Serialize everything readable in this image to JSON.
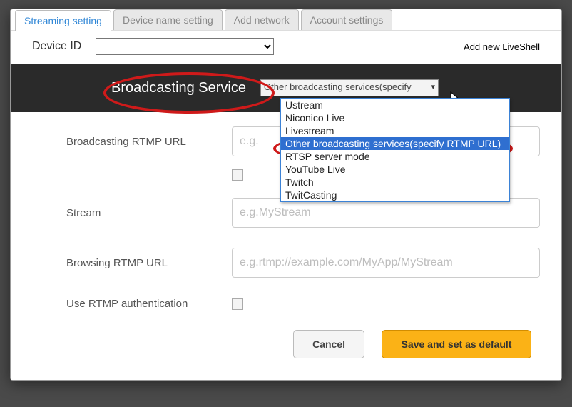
{
  "tabs": [
    "Streaming setting",
    "Device name setting",
    "Add network",
    "Account settings"
  ],
  "activeTab": 0,
  "deviceRow": {
    "label": "Device ID",
    "addLink": "Add new LiveShell"
  },
  "band": {
    "label": "Broadcasting Service",
    "selected": "Other broadcasting services(specify"
  },
  "dropdown": {
    "options": [
      "Ustream",
      "Niconico Live",
      "Livestream",
      "Other broadcasting services(specify RTMP URL)",
      "RTSP server mode",
      "YouTube Live",
      "Twitch",
      "TwitCasting"
    ],
    "highlightedIndex": 3
  },
  "form": {
    "rtmpUrl": {
      "label": "Broadcasting RTMP URL",
      "placeholder": "e.g."
    },
    "stream": {
      "label": "Stream",
      "placeholder": "e.g.MyStream"
    },
    "browse": {
      "label": "Browsing RTMP URL",
      "placeholder": "e.g.rtmp://example.com/MyApp/MyStream"
    },
    "auth": {
      "label": "Use RTMP authentication"
    }
  },
  "buttons": {
    "cancel": "Cancel",
    "save": "Save and set as default"
  }
}
